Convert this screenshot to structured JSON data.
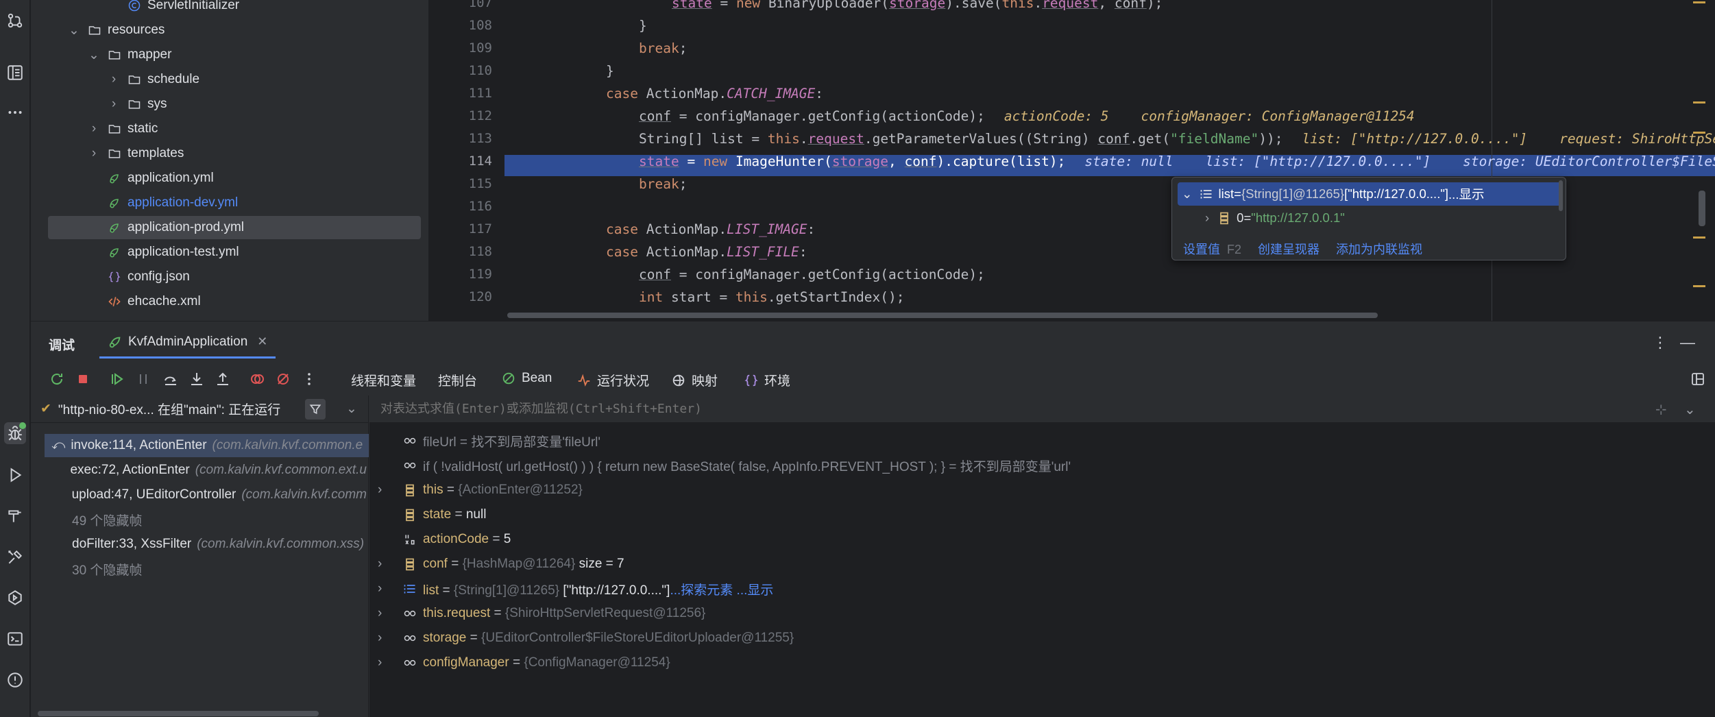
{
  "colors": {
    "accent": "#548af7",
    "exec_line": "#2f4d95",
    "string": "#6aab73",
    "keyword": "#cf8e6d",
    "field": "#c77dbb",
    "hint_value": "#d5b778"
  },
  "tree": {
    "items": [
      {
        "label": "ServletInitializer",
        "icon": "class-icon",
        "depth": 5,
        "expand": ""
      },
      {
        "label": "resources",
        "icon": "folder-icon",
        "depth": 3,
        "expand": "open"
      },
      {
        "label": "mapper",
        "icon": "folder-icon",
        "depth": 4,
        "expand": "open"
      },
      {
        "label": "schedule",
        "icon": "folder-icon",
        "depth": 5,
        "expand": "closed"
      },
      {
        "label": "sys",
        "icon": "folder-icon",
        "depth": 5,
        "expand": "closed"
      },
      {
        "label": "static",
        "icon": "folder-icon",
        "depth": 4,
        "expand": "closed"
      },
      {
        "label": "templates",
        "icon": "folder-icon",
        "depth": 4,
        "expand": "closed"
      },
      {
        "label": "application.yml",
        "icon": "spring-yml-icon",
        "depth": 4,
        "expand": ""
      },
      {
        "label": "application-dev.yml",
        "icon": "spring-yml-icon",
        "depth": 4,
        "expand": "",
        "modified": true
      },
      {
        "label": "application-prod.yml",
        "icon": "spring-yml-icon",
        "depth": 4,
        "expand": "",
        "selected": true
      },
      {
        "label": "application-test.yml",
        "icon": "spring-yml-icon",
        "depth": 4,
        "expand": ""
      },
      {
        "label": "config.json",
        "icon": "json-icon",
        "depth": 4,
        "expand": ""
      },
      {
        "label": "ehcache.xml",
        "icon": "xml-icon",
        "depth": 4,
        "expand": ""
      }
    ]
  },
  "editor": {
    "lines": [
      {
        "num": "107",
        "code": "state = new BinaryUploader(storage).save(this.request, conf);"
      },
      {
        "num": "108",
        "code": "}"
      },
      {
        "num": "109",
        "code": "break;"
      },
      {
        "num": "110",
        "code": "}"
      },
      {
        "num": "111",
        "code": "case ActionMap.CATCH_IMAGE:"
      },
      {
        "num": "112",
        "code": "conf = configManager.getConfig(actionCode);",
        "hint": "actionCode: 5    configManager: ConfigManager@11254"
      },
      {
        "num": "113",
        "code": "String[] list = this.request.getParameterValues((String) conf.get(\"fieldName\"));",
        "hint": "list: [\"http://127.0.0....\"]    request: ShiroHttpSe"
      },
      {
        "num": "114",
        "code": "state = new ImageHunter(storage, conf).capture(list);",
        "hint": "state: null    list: [\"http://127.0.0....\"]    storage: UEditorController$FileSt"
      },
      {
        "num": "115",
        "code": "break;"
      },
      {
        "num": "116",
        "code": ""
      },
      {
        "num": "117",
        "code": "case ActionMap.LIST_IMAGE:"
      },
      {
        "num": "118",
        "code": "case ActionMap.LIST_FILE:"
      },
      {
        "num": "119",
        "code": "conf = configManager.getConfig(actionCode);"
      },
      {
        "num": "120",
        "code": "int start = this.getStartIndex();"
      }
    ],
    "popup": {
      "row1_name": "list",
      "row1_eq": " = ",
      "row1_type": "{String[1]@11265}",
      "row1_value": " [\"http://127.0.0....\"]",
      "row1_link": " ...显示",
      "row2_index": "0",
      "row2_eq": " = ",
      "row2_value": "\"http://127.0.0.1\"",
      "action_set": "设置值",
      "action_set_key": "F2",
      "action_renderer": "创建呈现器",
      "action_watch": "添加为内联监视"
    }
  },
  "debug": {
    "title": "调试",
    "run_tab": "KvfAdminApplication",
    "tabs": [
      {
        "label": "线程和变量",
        "icon": ""
      },
      {
        "label": "控制台",
        "icon": ""
      },
      {
        "label": "Bean",
        "icon": "bean-icon"
      },
      {
        "label": "运行状况",
        "icon": "health-icon"
      },
      {
        "label": "映射",
        "icon": "mapping-icon"
      },
      {
        "label": "环境",
        "icon": "env-icon"
      }
    ],
    "thread": "\"http-nio-80-ex... 在组\"main\": 正在运行",
    "watch_placeholder": "对表达式求值(Enter)或添加监视(Ctrl+Shift+Enter)",
    "frames": [
      {
        "method": "invoke:114, ActionEnter",
        "pkg": "(com.kalvin.kvf.common.e",
        "current": true
      },
      {
        "method": "exec:72, ActionEnter",
        "pkg": "(com.kalvin.kvf.common.ext.u"
      },
      {
        "method": "upload:47, UEditorController",
        "pkg": "(com.kalvin.kvf.comm"
      },
      {
        "method": "49 个隐藏帧",
        "pkg": "",
        "hidden": true
      },
      {
        "method": "doFilter:33, XssFilter",
        "pkg": "(com.kalvin.kvf.common.xss)"
      },
      {
        "method": "30 个隐藏帧",
        "pkg": "",
        "hidden": true
      }
    ],
    "vars": [
      {
        "kind": "watch",
        "name": "fileUrl",
        "eq": " = ",
        "type": "",
        "value": "找不到局部变量'fileUrl'",
        "extra": "",
        "link": ""
      },
      {
        "kind": "watch",
        "name": "if ( !validHost( url.getHost() ) ) { return new BaseState( false, AppInfo.PREVENT_HOST ); }",
        "eq": " = ",
        "type": "",
        "value": "找不到局部变量'url'",
        "extra": "",
        "link": ""
      },
      {
        "kind": "object",
        "name": "this",
        "eq": " = ",
        "type": "{ActionEnter@11252}",
        "value": "",
        "extra": "",
        "link": "",
        "expandable": true
      },
      {
        "kind": "object",
        "name": "state",
        "eq": " = ",
        "type": "",
        "value": "null",
        "extra": "",
        "link": ""
      },
      {
        "kind": "primitive",
        "name": "actionCode",
        "eq": " = ",
        "type": "",
        "value": "5",
        "extra": "",
        "link": ""
      },
      {
        "kind": "object",
        "name": "conf",
        "eq": " = ",
        "type": "{HashMap@11264}",
        "value": "",
        "extra": "  size = 7",
        "link": "",
        "expandable": true
      },
      {
        "kind": "array",
        "name": "list",
        "eq": " = ",
        "type": "{String[1]@11265}",
        "value": "",
        "extra": " [\"http://127.0.0....\"]",
        "link": "...探索元素 ...显示",
        "expandable": true
      },
      {
        "kind": "field",
        "name": "this.request",
        "eq": " = ",
        "type": "{ShiroHttpServletRequest@11256}",
        "value": "",
        "extra": "",
        "link": "",
        "expandable": true
      },
      {
        "kind": "field",
        "name": "storage",
        "eq": " = ",
        "type": "{UEditorController$FileStoreUEditorUploader@11255}",
        "value": "",
        "extra": "",
        "link": "",
        "expandable": true
      },
      {
        "kind": "field",
        "name": "configManager",
        "eq": " = ",
        "type": "{ConfigManager@11254}",
        "value": "",
        "extra": "",
        "link": "",
        "expandable": true
      }
    ]
  }
}
